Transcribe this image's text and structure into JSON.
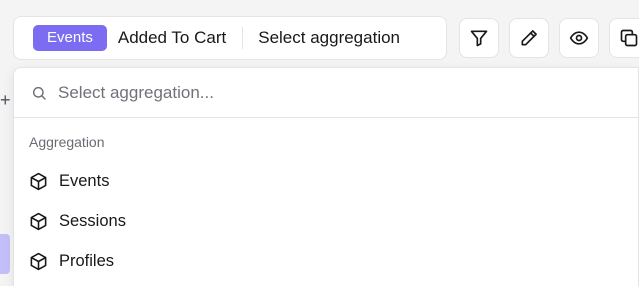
{
  "toolbar": {
    "badge_label": "Events",
    "event_name": "Added To Cart",
    "aggregation_label": "Select aggregation",
    "buttons": [
      {
        "icon": "filter-icon"
      },
      {
        "icon": "pencil-icon"
      },
      {
        "icon": "eye-icon"
      },
      {
        "icon": "copy-icon"
      }
    ]
  },
  "background": {
    "plus_glyph": "+"
  },
  "dropdown": {
    "search_placeholder": "Select aggregation...",
    "search_value": "",
    "group_label": "Aggregation",
    "options": [
      {
        "label": "Events",
        "icon": "cube-icon"
      },
      {
        "label": "Sessions",
        "icon": "cube-icon"
      },
      {
        "label": "Profiles",
        "icon": "cube-icon"
      }
    ]
  },
  "colors": {
    "accent": "#7c6cf2",
    "border": "#e4e4e7",
    "muted_text": "#71717a"
  }
}
